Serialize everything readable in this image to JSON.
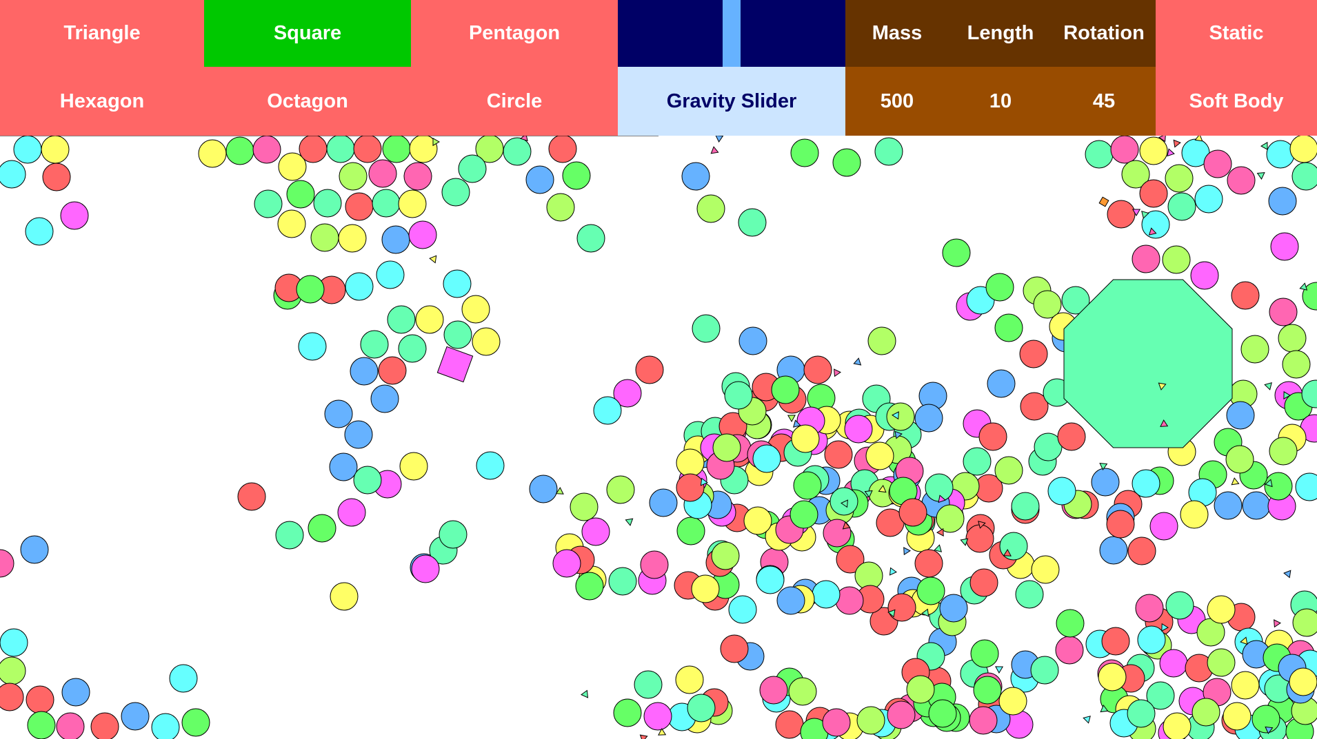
{
  "toolbar": {
    "shapes": [
      {
        "label": "Triangle",
        "active": false
      },
      {
        "label": "Square",
        "active": true
      },
      {
        "label": "Pentagon",
        "active": false
      },
      {
        "label": "Hexagon",
        "active": false
      },
      {
        "label": "Octagon",
        "active": false
      },
      {
        "label": "Circle",
        "active": false
      }
    ],
    "gravity_slider": {
      "label": "Gravity Slider",
      "value": 0.5
    },
    "properties": {
      "mass_label": "Mass",
      "mass_value": "500",
      "length_label": "Length",
      "length_value": "10",
      "rotation_label": "Rotation",
      "rotation_value": "45"
    },
    "modes": {
      "static_label": "Static",
      "soft_body_label": "Soft Body"
    }
  },
  "colors": {
    "shape_button": "#ff6666",
    "shape_button_active": "#00c800",
    "slider_track": "#000066",
    "slider_thumb": "#66b2ff",
    "slider_label_bg": "#cce5ff",
    "property_label_bg": "#663300",
    "property_value_bg": "#994c00",
    "ball_palette": [
      "#66ffff",
      "#ffff66",
      "#ff6666",
      "#66ff66",
      "#66ffb2",
      "#ff66b2",
      "#ff66ff",
      "#66b2ff",
      "#b2ff66",
      "#ff9933"
    ]
  }
}
